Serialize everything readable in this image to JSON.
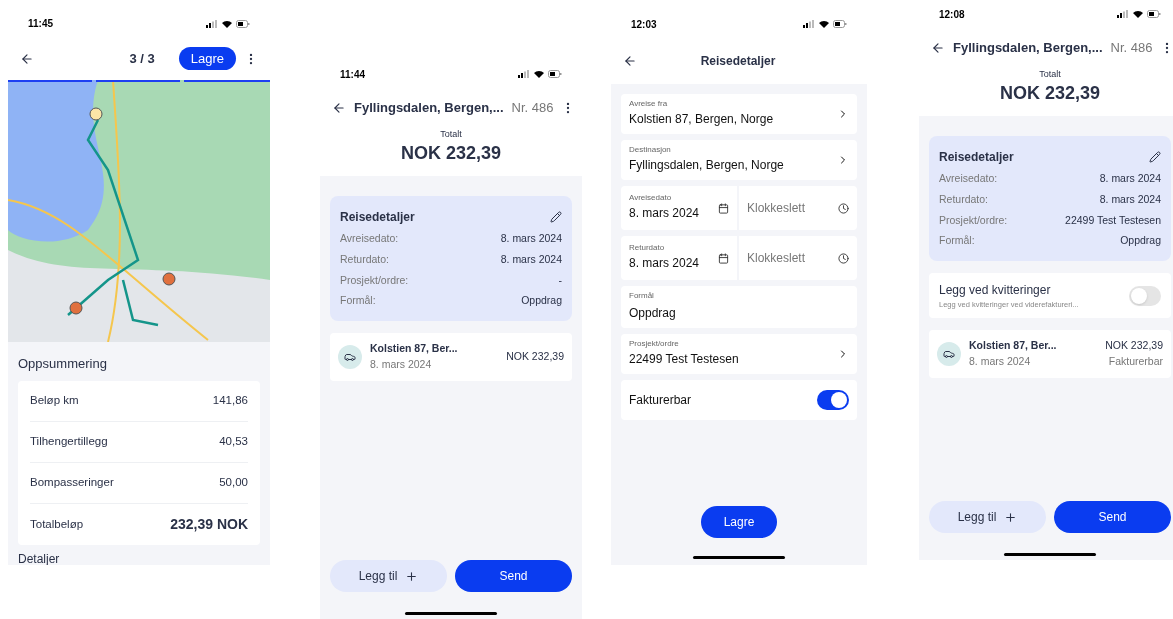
{
  "screens": [
    {
      "kind": "map_summary",
      "time": "11:45",
      "counter": "3 / 3",
      "save_label": "Lagre",
      "summary_title": "Oppsummering",
      "rows": [
        {
          "label": "Beløp km",
          "value": "141,86",
          "total": false
        },
        {
          "label": "Tilhengertillegg",
          "value": "40,53",
          "total": false
        },
        {
          "label": "Bompasseringer",
          "value": "50,00",
          "total": false
        },
        {
          "label": "Totalbeløp",
          "value": "232,39 NOK",
          "total": true
        }
      ],
      "next_heading": "Detaljer"
    },
    {
      "kind": "trip",
      "time": "11:44",
      "title": "Fyllingsdalen, Bergen,...",
      "number": "Nr. 486",
      "total_label": "Totalt",
      "total": "NOK 232,39",
      "details_title": "Reisedetaljer",
      "details": [
        {
          "label": "Avreisedato:",
          "value": "8. mars 2024"
        },
        {
          "label": "Returdato:",
          "value": "8. mars 2024"
        },
        {
          "label": "Prosjekt/ordre:",
          "value": "-"
        },
        {
          "label": "Formål:",
          "value": "Oppdrag"
        }
      ],
      "entries": [
        {
          "title": "Kolstien 87, Ber...",
          "date": "8. mars 2024",
          "amount": "NOK 232,39"
        }
      ],
      "add_label": "Legg til",
      "send_label": "Send"
    },
    {
      "kind": "form",
      "time": "12:03",
      "title": "Reisedetaljer",
      "fields": [
        {
          "kind": "select",
          "label": "Avreise fra",
          "value": "Kolstien 87, Bergen, Norge"
        },
        {
          "kind": "select",
          "label": "Destinasjon",
          "value": "Fyllingsdalen, Bergen, Norge"
        },
        {
          "kind": "datetime",
          "label": "Avreisedato",
          "value": "8. mars 2024",
          "placeholder": "Klokkeslett"
        },
        {
          "kind": "datetime",
          "label": "Returdato",
          "value": "8. mars 2024",
          "placeholder": "Klokkeslett"
        },
        {
          "kind": "text",
          "label": "Formål",
          "value": "Oppdrag"
        },
        {
          "kind": "select",
          "label": "Prosjekt/ordre",
          "value": "22499 Test Testesen"
        },
        {
          "kind": "toggle",
          "label": "Fakturerbar",
          "on": true
        }
      ],
      "save_label": "Lagre"
    },
    {
      "kind": "trip",
      "time": "12:08",
      "title": "Fyllingsdalen, Bergen,...",
      "number": "Nr. 486",
      "total_label": "Totalt",
      "total": "NOK 232,39",
      "details_title": "Reisedetaljer",
      "details": [
        {
          "label": "Avreisedato:",
          "value": "8. mars 2024"
        },
        {
          "label": "Returdato:",
          "value": "8. mars 2024"
        },
        {
          "label": "Prosjekt/ordre:",
          "value": "22499 Test Testesen"
        },
        {
          "label": "Formål:",
          "value": "Oppdrag"
        }
      ],
      "receipts": {
        "label": "Legg ved kvitteringer",
        "hint": "Legg ved kvitteringer ved viderefaktureri...",
        "on": false
      },
      "entries": [
        {
          "title": "Kolstien 87, Ber...",
          "date": "8. mars 2024",
          "amount": "NOK 232,39",
          "status": "Fakturerbar"
        }
      ],
      "add_label": "Legg til",
      "send_label": "Send"
    }
  ]
}
